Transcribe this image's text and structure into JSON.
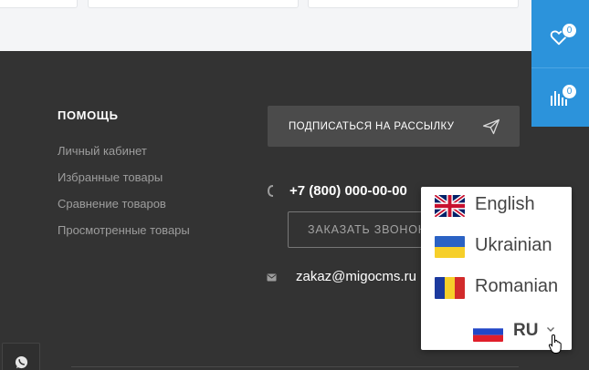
{
  "help": {
    "title": "ПОМОЩЬ",
    "links": [
      "Личный кабинет",
      "Избранные товары",
      "Сравнение товаров",
      "Просмотренные товары"
    ]
  },
  "subscribe": {
    "label": "ПОДПИСАТЬСЯ НА РАССЫЛКУ",
    "icon": "send-icon"
  },
  "contacts": {
    "phone": "+7 (800) 000-00-00",
    "callback_label": "ЗАКАЗАТЬ ЗВОНОК",
    "email": "zakaz@migocms.ru"
  },
  "side_panel": {
    "favorites_count": "0",
    "compare_count": "0",
    "color": "#2c93db"
  },
  "language": {
    "options": [
      {
        "label": "English",
        "flag": "uk-flag"
      },
      {
        "label": "Ukrainian",
        "flag": "ukraine-flag"
      },
      {
        "label": "Romanian",
        "flag": "romania-flag"
      }
    ],
    "current": "RU",
    "current_flag": "russia-flag"
  }
}
